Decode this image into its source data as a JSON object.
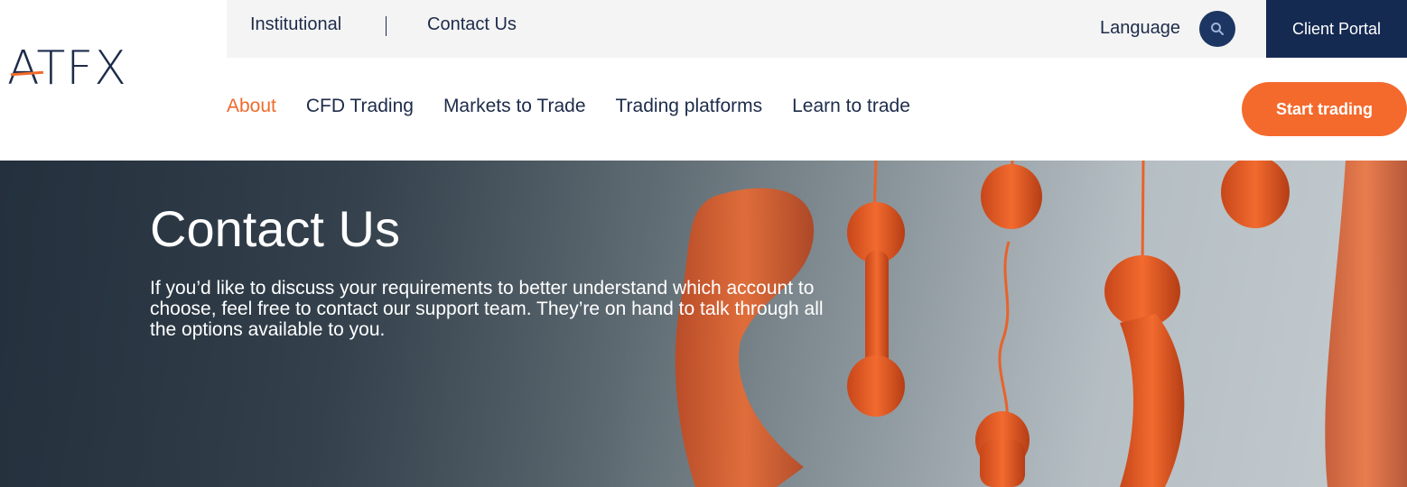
{
  "brand": {
    "logo_text": "ATFX",
    "accent_color": "#f06b2b",
    "primary_color": "#1d2b4a"
  },
  "topbar": {
    "links": [
      "Institutional",
      "Contact Us"
    ],
    "language_label": "Language",
    "search_icon": "search-icon",
    "client_portal_label": "Client Portal"
  },
  "nav": {
    "items": [
      "About",
      "CFD Trading",
      "Markets to Trade",
      "Trading platforms",
      "Learn to trade"
    ],
    "active_item": "About",
    "cta_label": "Start trading"
  },
  "hero": {
    "title": "Contact Us",
    "text": "If you’d like to discuss your requirements to better understand which account to choose, feel free to contact our support team. They’re on hand to talk through all the options available to you."
  }
}
